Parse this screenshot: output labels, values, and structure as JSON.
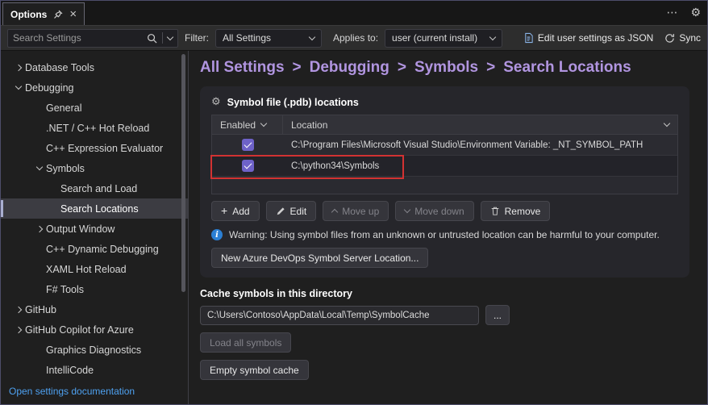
{
  "colors": {
    "accent_purple": "#b195e0",
    "checkbox_purple": "#6e62c8",
    "annotation_red": "#d23232",
    "link_blue": "#4ea1f0",
    "selection_bar": "#a9aed0"
  },
  "icons": {
    "plus": "+",
    "ellipsis": "⋯",
    "gear": "⚙",
    "close": "×"
  },
  "window": {
    "tab_title": "Options"
  },
  "toolbar": {
    "search_placeholder": "Search Settings",
    "filter_label": "Filter:",
    "filter_value": "All Settings",
    "applies_label": "Applies to:",
    "applies_value": "user (current install)",
    "edit_json_label": "Edit user settings as JSON",
    "sync_label": "Sync"
  },
  "sidebar": {
    "items": [
      {
        "label": "Database Tools"
      },
      {
        "label": "Debugging"
      },
      {
        "label": "General"
      },
      {
        "label": ".NET / C++ Hot Reload"
      },
      {
        "label": "C++ Expression Evaluator"
      },
      {
        "label": "Symbols"
      },
      {
        "label": "Search and Load"
      },
      {
        "label": "Search Locations"
      },
      {
        "label": "Output Window"
      },
      {
        "label": "C++ Dynamic Debugging"
      },
      {
        "label": "XAML Hot Reload"
      },
      {
        "label": "F# Tools"
      },
      {
        "label": "GitHub"
      },
      {
        "label": "GitHub Copilot for Azure"
      },
      {
        "label": "Graphics Diagnostics"
      },
      {
        "label": "IntelliCode"
      }
    ],
    "doc_link": "Open settings documentation"
  },
  "breadcrumb": {
    "separator": ">",
    "parts": [
      "All Settings",
      "Debugging",
      "Symbols",
      "Search Locations"
    ]
  },
  "symbols_panel": {
    "title": "Symbol file (.pdb) locations",
    "table": {
      "columns": [
        "Enabled",
        "Location"
      ],
      "rows": [
        {
          "enabled": true,
          "location": "C:\\Program Files\\Microsoft Visual Studio\\Environment Variable: _NT_SYMBOL_PATH"
        },
        {
          "enabled": true,
          "location": "C:\\python34\\Symbols",
          "annotated": true
        }
      ]
    },
    "buttons": {
      "add": "Add",
      "edit": "Edit",
      "move_up": "Move up",
      "move_down": "Move down",
      "remove": "Remove"
    },
    "warning": "Warning: Using symbol files from an unknown or untrusted location can be harmful to your computer.",
    "azure_button": "New Azure DevOps Symbol Server Location..."
  },
  "cache_section": {
    "title": "Cache symbols in this directory",
    "path_value": "C:\\Users\\Contoso\\AppData\\Local\\Temp\\SymbolCache",
    "browse_label": "...",
    "load_all_label": "Load all symbols",
    "empty_cache_label": "Empty symbol cache"
  }
}
